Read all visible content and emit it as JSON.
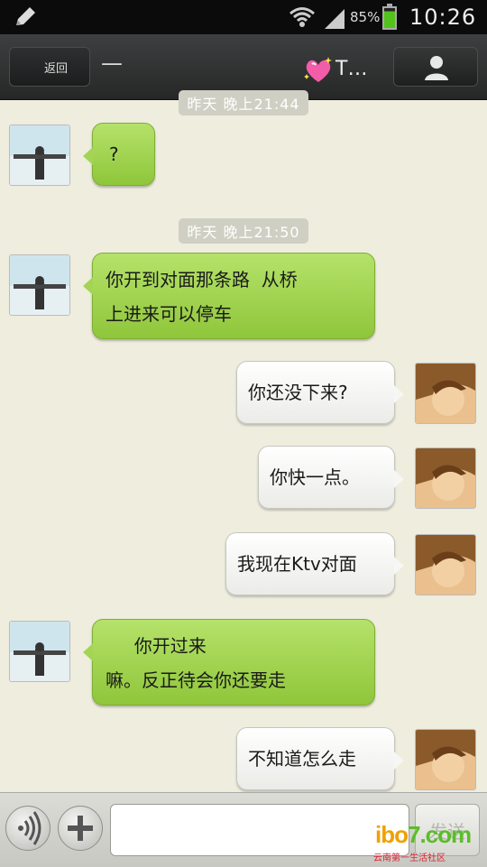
{
  "status_bar": {
    "battery_percent": "85%",
    "battery_level": 0.85,
    "time": "10:26",
    "icons": [
      "edit-pen-icon",
      "wifi-icon",
      "signal-icon",
      "battery-icon"
    ]
  },
  "title_bar": {
    "back_label": "返回",
    "dash": "—",
    "contact_name": "T…",
    "icons": [
      "sparkle-heart-icon",
      "profile-icon"
    ]
  },
  "timestamps": [
    "昨天 晚上21:44",
    "昨天 晚上21:50"
  ],
  "messages": [
    {
      "from": "contact",
      "lines": [
        "?"
      ]
    },
    {
      "from": "contact",
      "lines": [
        "你开到对面那条路  从桥",
        "上进来可以停车"
      ]
    },
    {
      "from": "me",
      "lines": [
        "你还没下来?"
      ]
    },
    {
      "from": "me",
      "lines": [
        "你快一点。"
      ]
    },
    {
      "from": "me",
      "lines": [
        "我现在Ktv对面"
      ]
    },
    {
      "from": "contact",
      "lines": [
        "     你开过来",
        "嘛。反正待会你还要走"
      ]
    },
    {
      "from": "me",
      "lines": [
        "不知道怎么走"
      ]
    }
  ],
  "input_bar": {
    "message_value": "",
    "send_label": "发送",
    "icons": [
      "voice-icon",
      "plus-icon"
    ]
  },
  "watermark": {
    "logo_text": "ibo7.com",
    "logo_part1": "ibo",
    "logo_part2": "7.com",
    "subtitle": "云南第一生活社区"
  },
  "colors": {
    "background": "#eeedde",
    "contact_bubble": "#a4d456",
    "my_bubble": "#ffffff",
    "titlebar": "#2f3030"
  }
}
